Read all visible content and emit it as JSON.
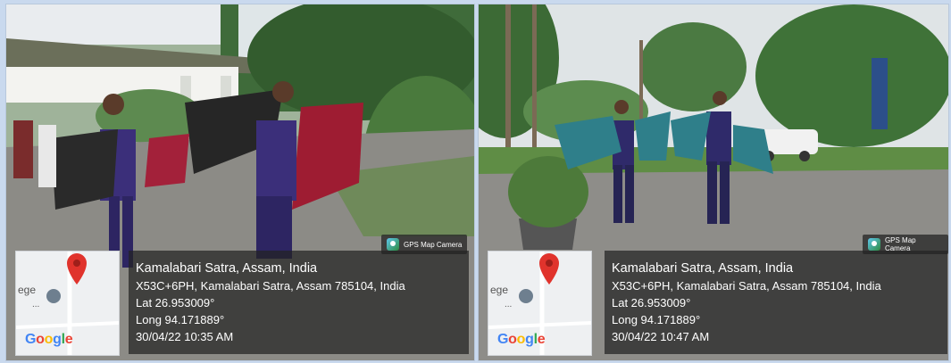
{
  "photos": [
    {
      "badge": "GPS Map Camera",
      "map": {
        "label": "ege",
        "ellipsis": "...",
        "logo": "Google"
      },
      "location_title": "Kamalabari Satra, Assam, India",
      "address": "X53C+6PH, Kamalabari Satra, Assam 785104, India",
      "lat": "Lat 26.953009°",
      "long": "Long 94.171889°",
      "datetime": "30/04/22 10:35 AM"
    },
    {
      "badge": "GPS Map Camera",
      "map": {
        "label": "ege",
        "ellipsis": "...",
        "logo": "Google"
      },
      "location_title": "Kamalabari Satra, Assam, India",
      "address": "X53C+6PH, Kamalabari Satra, Assam 785104, India",
      "lat": "Lat 26.953009°",
      "long": "Long 94.171889°",
      "datetime": "30/04/22 10:47 AM"
    }
  ],
  "colors": {
    "pin": "#e0332c",
    "google_blue": "#4285f4",
    "google_red": "#ea4335",
    "google_yellow": "#fbbc05",
    "google_green": "#34a853"
  }
}
